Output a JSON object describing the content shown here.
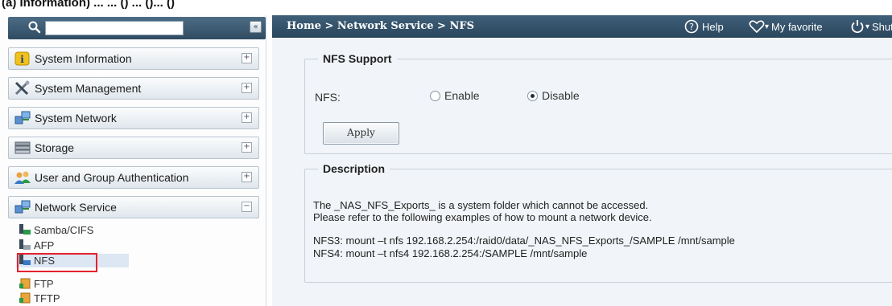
{
  "caption": "(a) Information) ... ... () ... ()... ()",
  "sidebar": {
    "search": {
      "value": "",
      "placeholder": ""
    },
    "collapse_glyph": "«",
    "menu": [
      {
        "label": "System Information",
        "icon": "info-icon",
        "toggle": "+"
      },
      {
        "label": "System Management",
        "icon": "tools-icon",
        "toggle": "+"
      },
      {
        "label": "System Network",
        "icon": "network-icon",
        "toggle": "+"
      },
      {
        "label": "Storage",
        "icon": "storage-icon",
        "toggle": "+"
      },
      {
        "label": "User and Group Authentication",
        "icon": "users-icon",
        "toggle": "+"
      },
      {
        "label": "Network Service",
        "icon": "network-service-icon",
        "toggle": "−"
      }
    ],
    "subitems": [
      {
        "label": "Samba/CIFS",
        "icon": "samba-icon"
      },
      {
        "label": "AFP",
        "icon": "afp-icon"
      },
      {
        "label": "NFS",
        "icon": "nfs-icon",
        "selected": true
      },
      {
        "label": "FTP",
        "icon": "ftp-icon"
      },
      {
        "label": "TFTP",
        "icon": "tftp-icon"
      }
    ]
  },
  "topbar": {
    "breadcrumb": "Home > Network Service > NFS",
    "help": "Help",
    "favorite": "My favorite",
    "shutdown": "Shut"
  },
  "nfs_support": {
    "legend": "NFS Support",
    "field_label": "NFS:",
    "options": [
      "Enable",
      "Disable"
    ],
    "selected": "Disable",
    "apply": "Apply"
  },
  "description": {
    "legend": "Description",
    "lines": [
      "The _NAS_NFS_Exports_ is a system folder which cannot be accessed.",
      "Please refer to the following examples of how to mount a network device.",
      "NFS3: mount –t nfs 192.168.2.254:/raid0/data/_NAS_NFS_Exports_/SAMPLE   /mnt/sample",
      "NFS4: mount –t nfs4 192.168.2.254:/SAMPLE   /mnt/sample"
    ]
  },
  "colors": {
    "topbar": "#2f4b61",
    "selection_box": "#e3232f",
    "content_bg": "#f1f4f8"
  }
}
